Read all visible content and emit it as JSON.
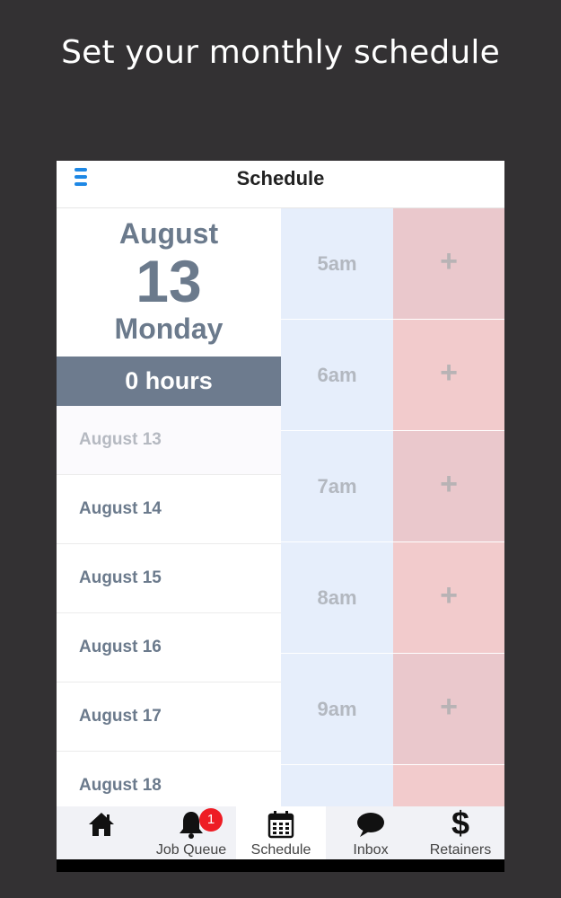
{
  "promo": {
    "title": "Set your monthly schedule"
  },
  "header": {
    "title": "Schedule",
    "menu_icon": "hamburger-menu-icon"
  },
  "selected_date": {
    "month": "August",
    "day": "13",
    "weekday": "Monday",
    "hours": "0 hours"
  },
  "day_list": [
    {
      "label": "August 13",
      "selected": true
    },
    {
      "label": "August 14",
      "selected": false
    },
    {
      "label": "August 15",
      "selected": false
    },
    {
      "label": "August 16",
      "selected": false
    },
    {
      "label": "August 17",
      "selected": false
    },
    {
      "label": "August 18",
      "selected": false
    }
  ],
  "time_slots": [
    {
      "label": "5am",
      "add": "+"
    },
    {
      "label": "6am",
      "add": "+"
    },
    {
      "label": "7am",
      "add": "+"
    },
    {
      "label": "8am",
      "add": "+"
    },
    {
      "label": "9am",
      "add": "+"
    },
    {
      "label": "",
      "add": ""
    }
  ],
  "bottom_nav": [
    {
      "label": "",
      "icon": "home-icon"
    },
    {
      "label": "Job Queue",
      "icon": "bell-icon",
      "badge": "1"
    },
    {
      "label": "Schedule",
      "icon": "calendar-icon",
      "active": true
    },
    {
      "label": "Inbox",
      "icon": "chat-bubble-icon"
    },
    {
      "label": "Retainers",
      "icon": "dollar-icon",
      "glyph": "$"
    }
  ],
  "colors": {
    "background": "#333133",
    "accent_blue": "#1e88e5",
    "slate": "#6d7b8e",
    "time_column": "#e6eefb",
    "add_column": "#eac8cc",
    "badge_red": "#ee1c24"
  }
}
